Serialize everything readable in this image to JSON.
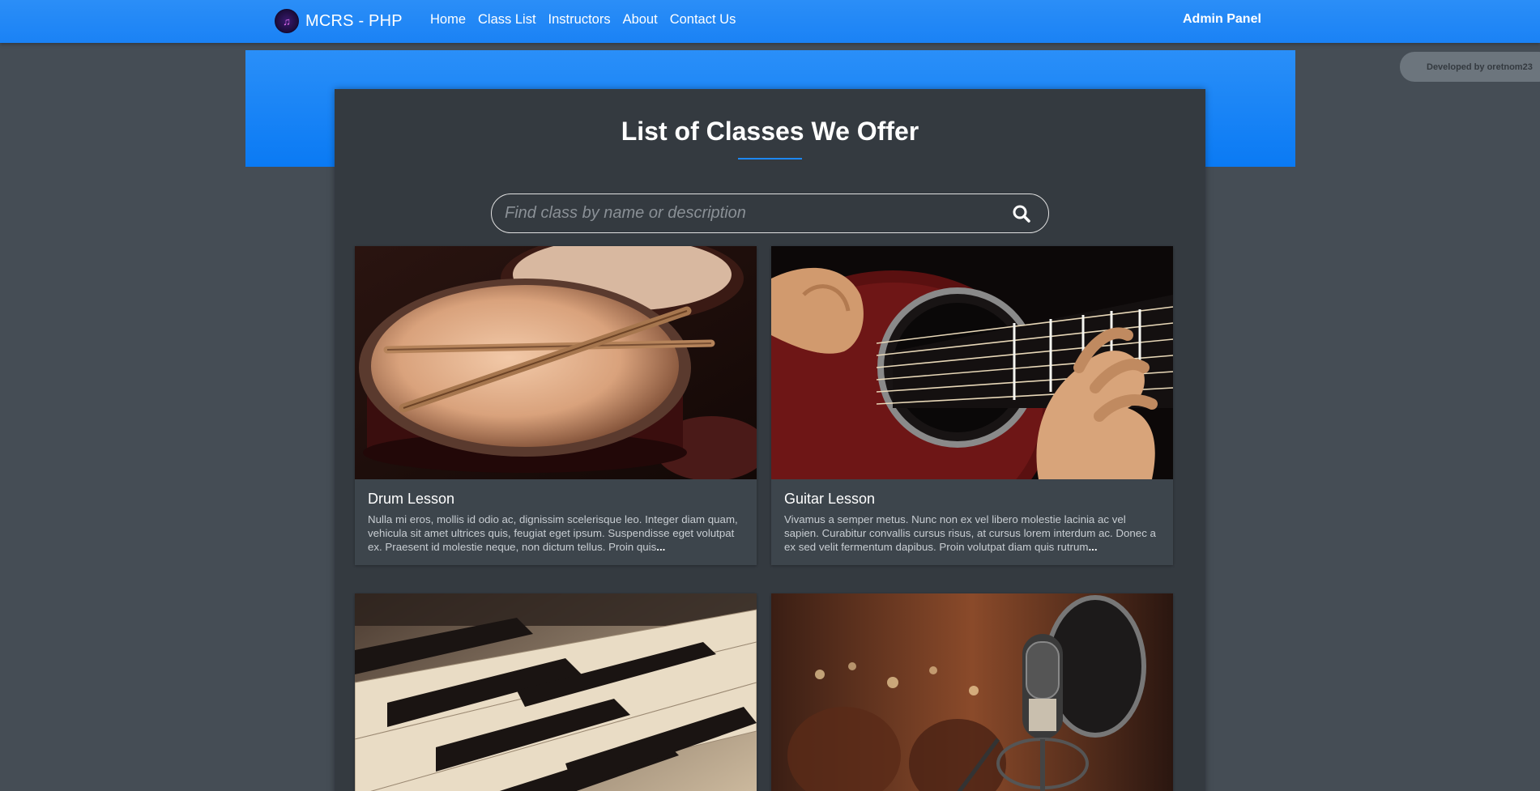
{
  "navbar": {
    "brand_name": "MCRS - PHP",
    "brand_logo_icon": "music-note-icon",
    "links": [
      "Home",
      "Class List",
      "Instructors",
      "About",
      "Contact Us"
    ],
    "admin_label": "Admin Panel"
  },
  "dev_badge": "Developed by oretnom23",
  "main": {
    "title": "List of Classes We Offer",
    "search": {
      "placeholder": "Find class by name or description",
      "value": "",
      "icon": "search-icon"
    },
    "classes": [
      {
        "title": "Drum Lesson",
        "description": "Nulla mi eros, mollis id odio ac, dignissim scelerisque leo. Integer diam quam, vehicula sit amet ultrices quis, feugiat eget ipsum. Suspendisse eget volutpat ex. Praesent id molestie neque, non dictum tellus. Proin quis",
        "ellipsis": "...",
        "image": "drum-snare-photo"
      },
      {
        "title": "Guitar Lesson",
        "description": "Vivamus a semper metus. Nunc non ex vel libero molestie lacinia ac vel sapien. Curabitur convallis cursus risus, at cursus lorem interdum ac. Donec a ex sed velit fermentum dapibus. Proin volutpat diam quis rutrum",
        "ellipsis": "...",
        "image": "acoustic-guitar-photo"
      },
      {
        "title": "",
        "description": "",
        "image": "piano-keys-photo"
      },
      {
        "title": "",
        "description": "",
        "image": "studio-microphone-photo"
      }
    ]
  },
  "colors": {
    "navbar": "#1a82f5",
    "page_bg": "#454d55",
    "card_bg": "#343a40",
    "class_card_bg": "#3d454c",
    "accent": "#1e88f6"
  }
}
